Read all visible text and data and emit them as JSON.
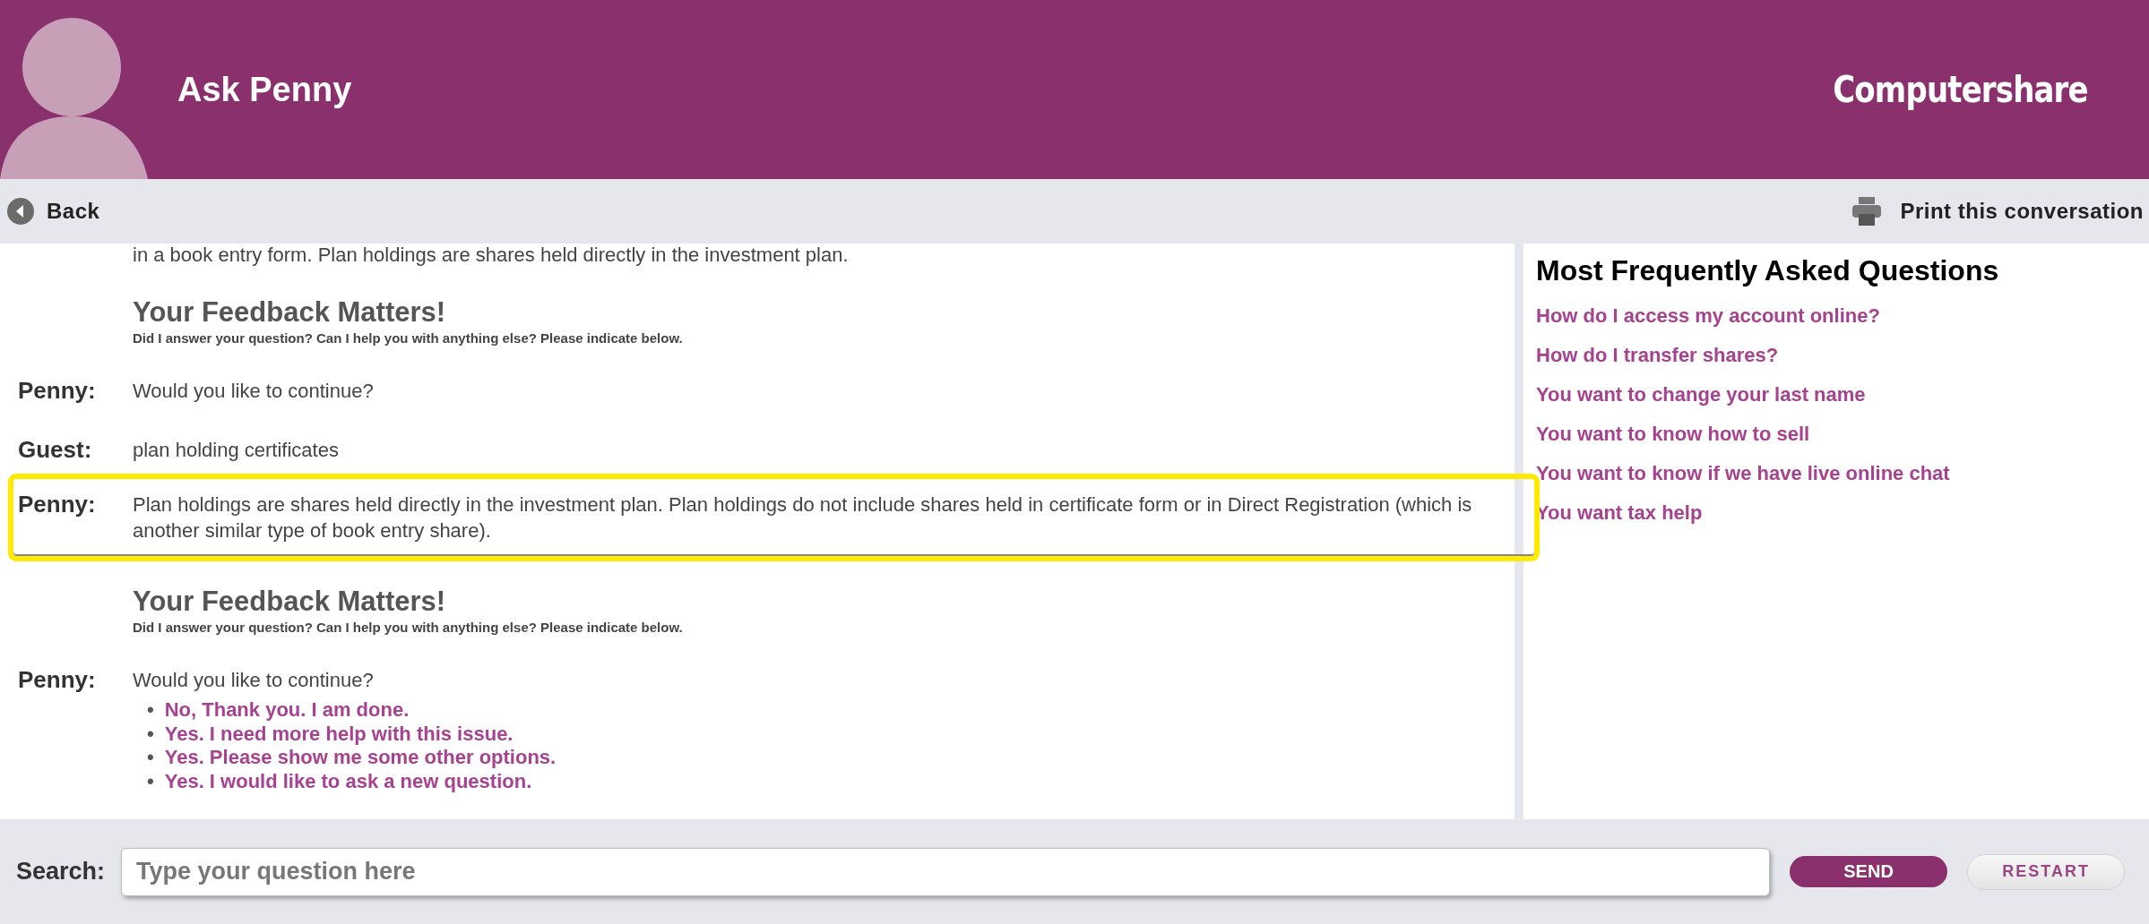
{
  "header": {
    "title": "Ask Penny",
    "logo": "Computershare"
  },
  "toolbar": {
    "back": "Back",
    "print": "Print this conversation"
  },
  "conversation": [
    {
      "kind": "text",
      "text": "in a book entry form. Plan holdings are shares held directly in the investment plan."
    },
    {
      "kind": "feedback",
      "title": "Your Feedback Matters!",
      "subtitle": "Did I answer your question? Can I help you with anything else? Please indicate below."
    },
    {
      "kind": "message",
      "speaker": "Penny:",
      "text": "Would you like to continue?",
      "highlighted": false
    },
    {
      "kind": "message",
      "speaker": "Guest:",
      "text": "plan holding certificates",
      "highlighted": false
    },
    {
      "kind": "message",
      "speaker": "Penny:",
      "text": "Plan holdings are shares held directly in the investment plan. Plan holdings do not include shares held in certificate form or in Direct Registration (which is another similar type of book entry share).",
      "highlighted": true
    },
    {
      "kind": "feedback",
      "title": "Your Feedback Matters!",
      "subtitle": "Did I answer your question? Can I help you with anything else? Please indicate below."
    },
    {
      "kind": "message",
      "speaker": "Penny:",
      "text": "Would you like to continue?",
      "highlighted": false,
      "options": [
        {
          "marker": "•",
          "text": "No, Thank you. I am done."
        },
        {
          "marker": "•",
          "text": "Yes. I need more help with this issue."
        },
        {
          "marker": "•",
          "text": "Yes. Please show me some other options."
        },
        {
          "marker": "•",
          "text": "Yes. I would like to ask a new question."
        }
      ]
    }
  ],
  "faq": {
    "title": "Most Frequently Asked Questions",
    "items": [
      "How do I access my account online?",
      "How do I transfer shares?",
      "You want to change your last name",
      "You want to know how to sell",
      "You want to know if we have live online chat",
      "You want tax help"
    ]
  },
  "search": {
    "label": "Search:",
    "placeholder": "Type your question here",
    "send": "SEND",
    "restart": "RESTART"
  }
}
